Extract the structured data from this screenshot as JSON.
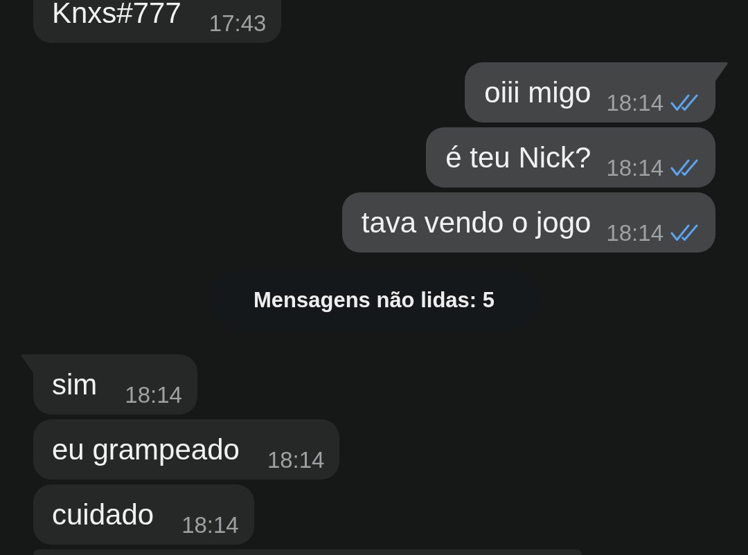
{
  "conversation": [
    {
      "kind": "incoming",
      "text": "Knxs#777",
      "time": "17:43",
      "tail": false
    },
    {
      "kind": "outgoing",
      "text": "oiii migo",
      "time": "18:14",
      "read": true,
      "tail": true
    },
    {
      "kind": "outgoing",
      "text": "é teu Nick?",
      "time": "18:14",
      "read": true,
      "tail": false
    },
    {
      "kind": "outgoing",
      "text": "tava vendo o jogo",
      "time": "18:14",
      "read": true,
      "tail": false
    },
    {
      "kind": "divider",
      "text": "Mensagens não lidas: 5"
    },
    {
      "kind": "incoming",
      "text": "sim",
      "time": "18:14",
      "tail": true
    },
    {
      "kind": "incoming",
      "text": "eu grampeado",
      "time": "18:14",
      "tail": false
    },
    {
      "kind": "incoming",
      "text": "cuidado",
      "time": "18:14",
      "tail": false
    },
    {
      "kind": "incoming"
    }
  ]
}
